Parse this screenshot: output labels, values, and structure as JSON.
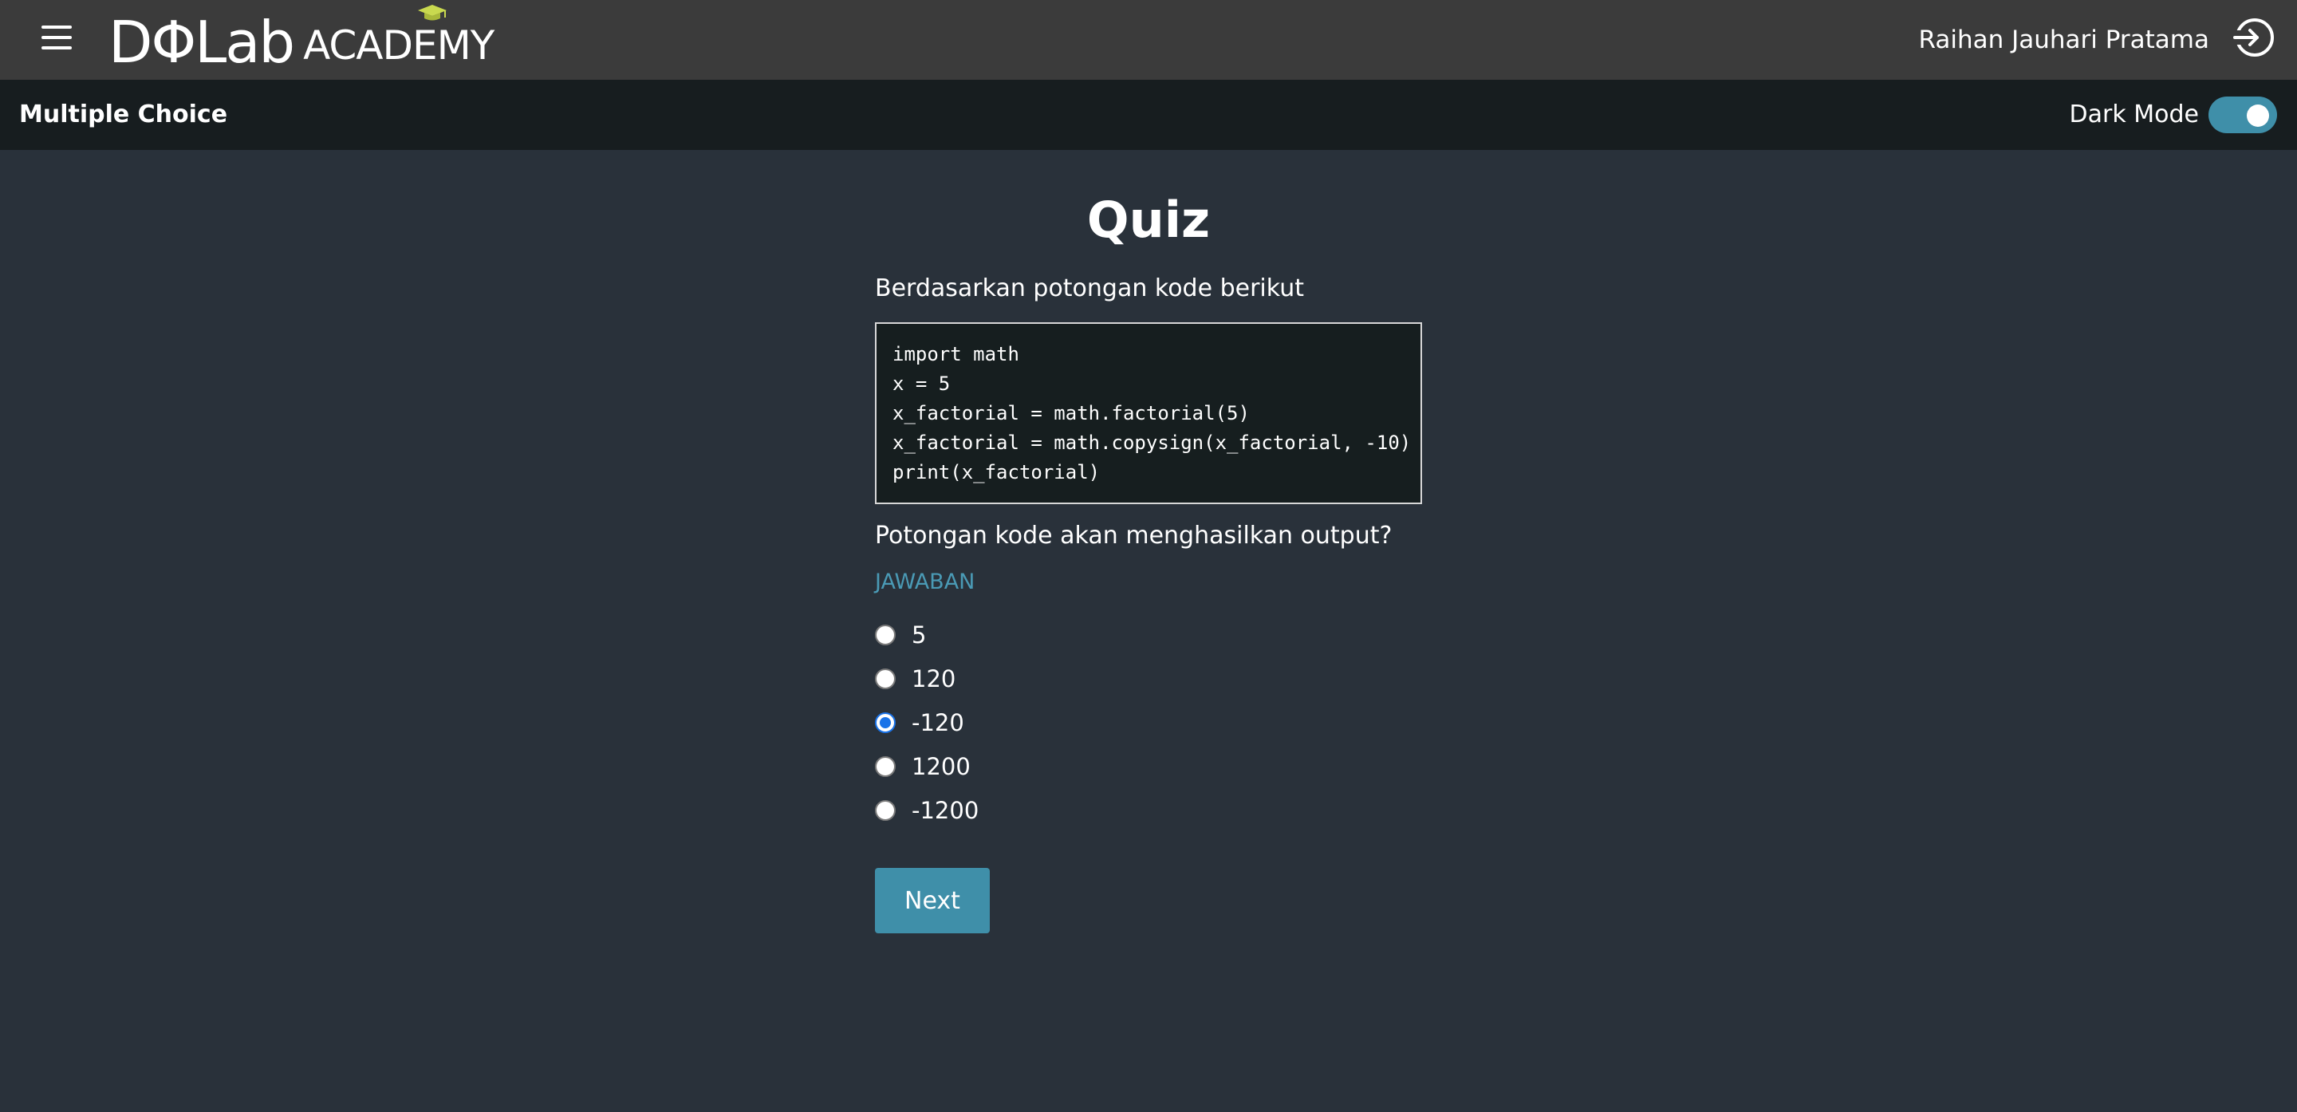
{
  "header": {
    "logo_main": "DΦLab",
    "logo_sub": "ACADEMY",
    "user_name": "Raihan Jauhari Pratama",
    "menu_icon": "hamburger-menu-icon",
    "logout_icon": "logout-arrow-icon",
    "bg_color": "#3b3b3b"
  },
  "subheader": {
    "title": "Multiple Choice",
    "dark_mode_label": "Dark Mode",
    "dark_mode_on": true,
    "accent_color": "#3f8fa9"
  },
  "quiz": {
    "title": "Quiz",
    "intro": "Berdasarkan potongan kode berikut",
    "code_lines": [
      "import math",
      "x = 5",
      "x_factorial = math.factorial(5)",
      "x_factorial = math.copysign(x_factorial, -10)",
      "print(x_factorial)"
    ],
    "question": "Potongan kode akan menghasilkan output?",
    "answer_label": "JAWABAN",
    "options": [
      {
        "label": "5",
        "checked": false
      },
      {
        "label": "120",
        "checked": false
      },
      {
        "label": "-120",
        "checked": true
      },
      {
        "label": "1200",
        "checked": false
      },
      {
        "label": "-1200",
        "checked": false
      }
    ],
    "next_label": "Next"
  }
}
